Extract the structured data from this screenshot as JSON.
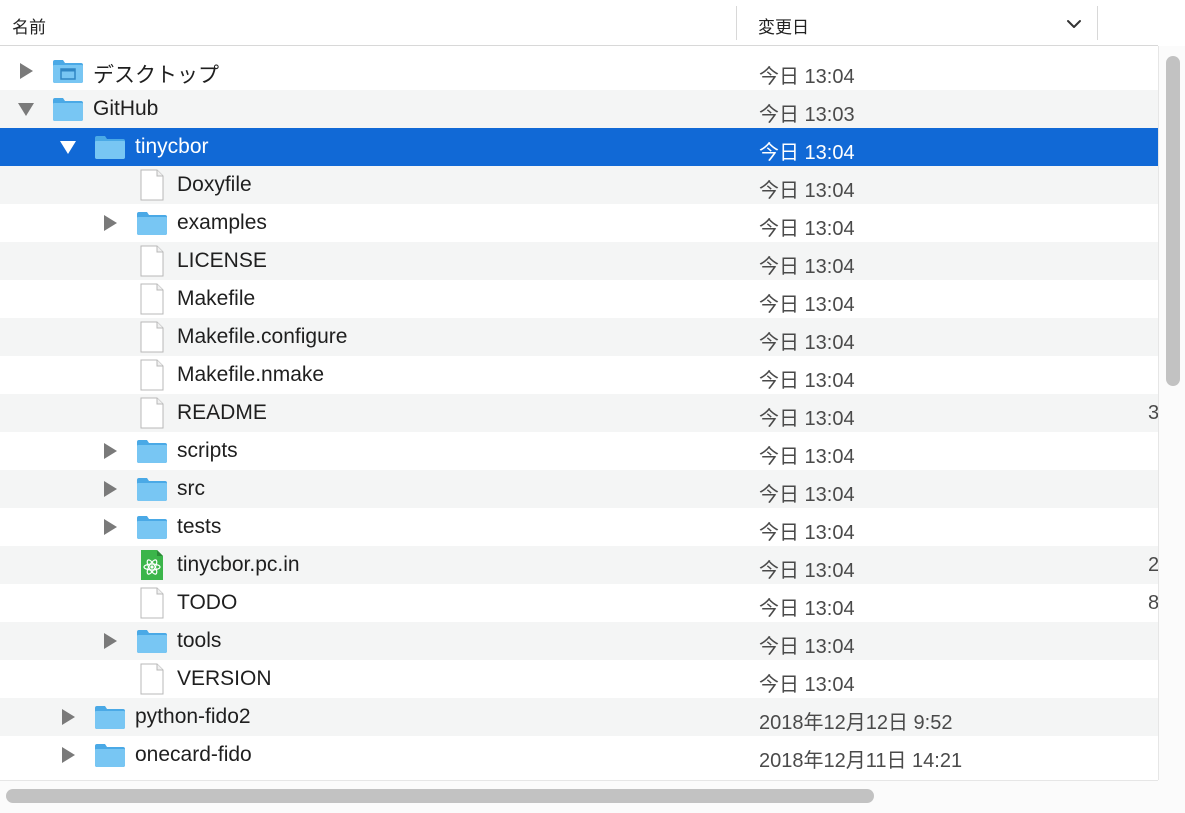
{
  "header": {
    "name_label": "名前",
    "date_label": "変更日"
  },
  "rows": [
    {
      "name": "デスクトップ",
      "date": "今日 13:04",
      "type": "desktop-folder",
      "disclosure": "collapsed",
      "size": ""
    },
    {
      "name": "GitHub",
      "date": "今日 13:03",
      "type": "folder",
      "disclosure": "expanded",
      "size": ""
    },
    {
      "name": "tinycbor",
      "date": "今日 13:04",
      "type": "folder",
      "disclosure": "expanded",
      "size": "",
      "selected": true
    },
    {
      "name": "Doxyfile",
      "date": "今日 13:04",
      "type": "file",
      "disclosure": "none",
      "size": ""
    },
    {
      "name": "examples",
      "date": "今日 13:04",
      "type": "folder",
      "disclosure": "collapsed",
      "size": ""
    },
    {
      "name": "LICENSE",
      "date": "今日 13:04",
      "type": "file",
      "disclosure": "none",
      "size": ""
    },
    {
      "name": "Makefile",
      "date": "今日 13:04",
      "type": "file",
      "disclosure": "none",
      "size": ""
    },
    {
      "name": "Makefile.configure",
      "date": "今日 13:04",
      "type": "file",
      "disclosure": "none",
      "size": ""
    },
    {
      "name": "Makefile.nmake",
      "date": "今日 13:04",
      "type": "file",
      "disclosure": "none",
      "size": ""
    },
    {
      "name": "README",
      "date": "今日 13:04",
      "type": "file",
      "disclosure": "none",
      "size": "3"
    },
    {
      "name": "scripts",
      "date": "今日 13:04",
      "type": "folder",
      "disclosure": "collapsed",
      "size": ""
    },
    {
      "name": "src",
      "date": "今日 13:04",
      "type": "folder",
      "disclosure": "collapsed",
      "size": ""
    },
    {
      "name": "tests",
      "date": "今日 13:04",
      "type": "folder",
      "disclosure": "collapsed",
      "size": ""
    },
    {
      "name": "tinycbor.pc.in",
      "date": "今日 13:04",
      "type": "atom-file",
      "disclosure": "none",
      "size": "2"
    },
    {
      "name": "TODO",
      "date": "今日 13:04",
      "type": "file",
      "disclosure": "none",
      "size": "8"
    },
    {
      "name": "tools",
      "date": "今日 13:04",
      "type": "folder",
      "disclosure": "collapsed",
      "size": ""
    },
    {
      "name": "VERSION",
      "date": "今日 13:04",
      "type": "file",
      "disclosure": "none",
      "size": ""
    },
    {
      "name": "python-fido2",
      "date": "2018年12月12日 9:52",
      "type": "folder",
      "disclosure": "collapsed",
      "size": ""
    },
    {
      "name": "onecard-fido",
      "date": "2018年12月11日 14:21",
      "type": "folder",
      "disclosure": "collapsed",
      "size": ""
    }
  ],
  "colors": {
    "selection": "#1169d6",
    "folder": "#5fb8ee",
    "alt_row": "#f4f5f5"
  }
}
